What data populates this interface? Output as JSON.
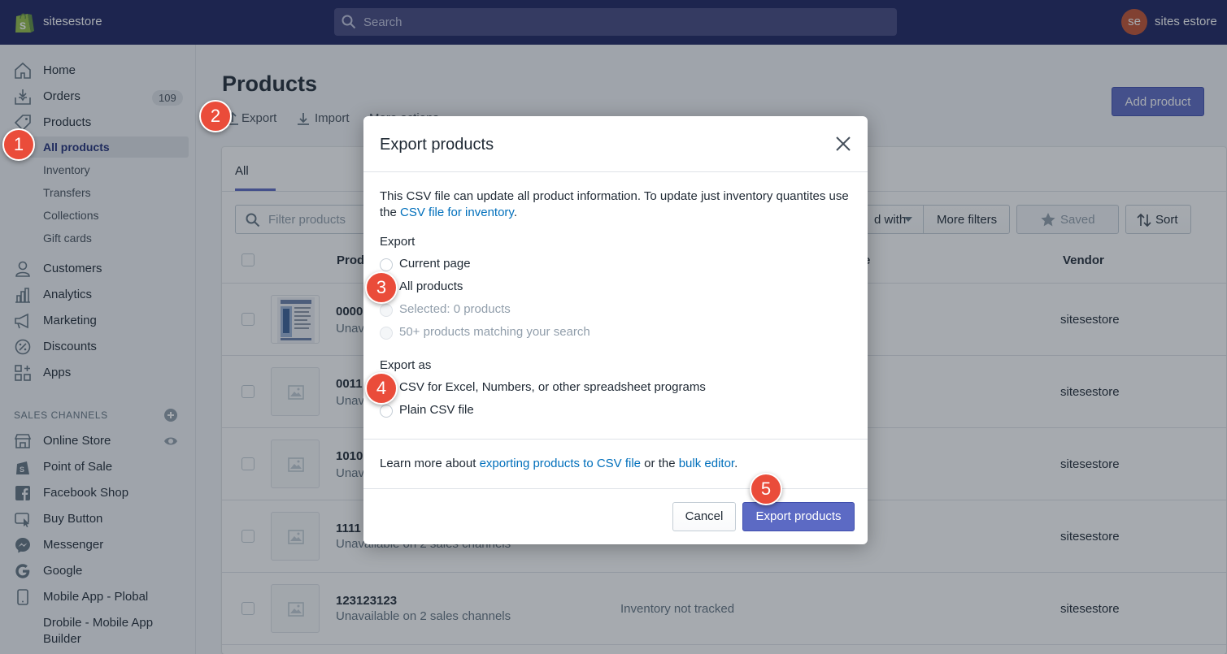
{
  "app": {
    "store_name": "sitesestore",
    "search_placeholder": "Search",
    "avatar_initials": "se",
    "user_name": "sites estore"
  },
  "sidebar": {
    "home": "Home",
    "orders": "Orders",
    "orders_count": "109",
    "products": "Products",
    "sub": [
      "All products",
      "Inventory",
      "Transfers",
      "Collections",
      "Gift cards"
    ],
    "customers": "Customers",
    "analytics": "Analytics",
    "marketing": "Marketing",
    "discounts": "Discounts",
    "apps": "Apps",
    "sales_channels_title": "SALES CHANNELS",
    "channels": [
      "Online Store",
      "Point of Sale",
      "Facebook Shop",
      "Buy Button",
      "Messenger",
      "Google",
      "Mobile App - Plobal",
      "Drobile - Mobile App",
      "Builder"
    ]
  },
  "page": {
    "title": "Products",
    "export_label": "Export",
    "import_label": "Import",
    "more_actions_label": "More actions",
    "add_product_label": "Add product",
    "tab_all": "All",
    "filter_placeholder": "Filter products",
    "tagged_with_label": "d with",
    "more_filters_label": "More filters",
    "saved_label": "Saved",
    "sort_label": "Sort",
    "col_product": "Produ",
    "col_type": "e",
    "col_vendor": "Vendor",
    "rows": [
      {
        "name": "0000",
        "sub": "Unava",
        "inventory": "",
        "vendor": "sitesestore"
      },
      {
        "name": "0011",
        "sub": "Unava",
        "inventory": "",
        "vendor": "sitesestore"
      },
      {
        "name": "1010",
        "sub": "Unava",
        "inventory": "",
        "vendor": "sitesestore"
      },
      {
        "name": "1111",
        "sub": "Unavailable on 2 sales channels",
        "inventory": "",
        "vendor": "sitesestore"
      },
      {
        "name": "123123123",
        "sub": "Unavailable on 2 sales channels",
        "inventory": "Inventory not tracked",
        "vendor": "sitesestore"
      }
    ]
  },
  "modal": {
    "title": "Export products",
    "intro_line1": "This CSV file can update all product information. To update just inventory quantites use",
    "intro_the": "the ",
    "intro_link": "CSV file for inventory",
    "intro_end": ".",
    "export_heading": "Export",
    "export_options": [
      "Current page",
      "All products",
      "Selected: 0 products",
      "50+ products matching your search"
    ],
    "export_as_heading": "Export as",
    "export_as_options": [
      "CSV for Excel, Numbers, or other spreadsheet programs",
      "Plain CSV file"
    ],
    "learn_prefix": "Learn more about ",
    "learn_link1": "exporting products to CSV file",
    "learn_mid": " or the ",
    "learn_link2": "bulk editor",
    "learn_end": ".",
    "cancel_label": "Cancel",
    "export_button_label": "Export products"
  },
  "steps": [
    "1",
    "2",
    "3",
    "4",
    "5"
  ],
  "colors": {
    "topbar": "#1c2260",
    "accent": "#5c6ac4",
    "step": "#ea4c3a",
    "link": "#006fbb"
  }
}
